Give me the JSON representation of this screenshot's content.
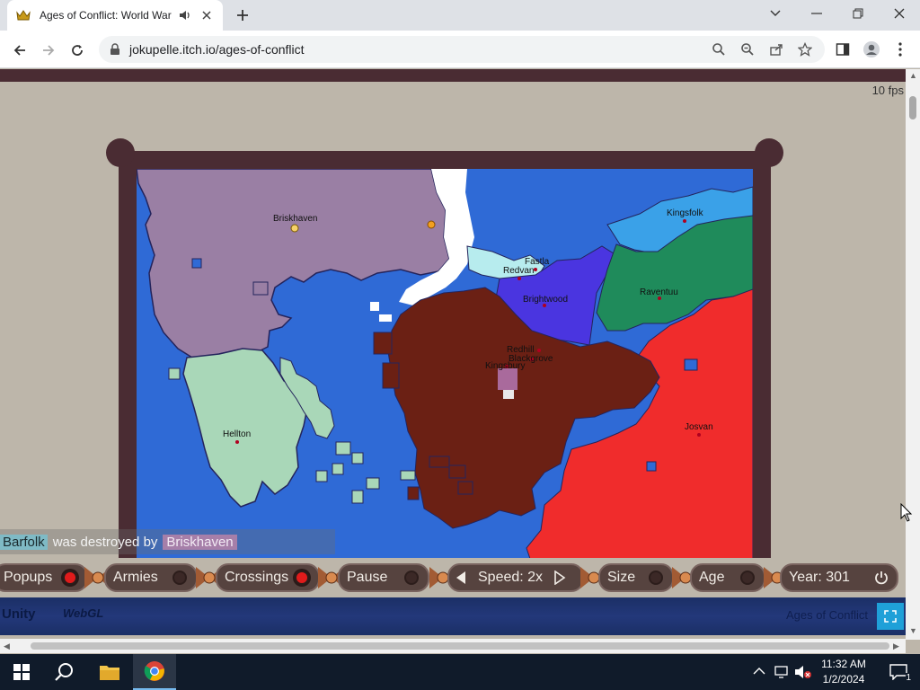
{
  "browser": {
    "tab_title": "Ages of Conflict: World War",
    "url": "jokupelle.itch.io/ages-of-conflict"
  },
  "game": {
    "fps": "10 fps",
    "cities": [
      {
        "name": "Briskhaven"
      },
      {
        "name": "Kingsfolk"
      },
      {
        "name": "Fastla"
      },
      {
        "name": "Redvan"
      },
      {
        "name": "Brightwood"
      },
      {
        "name": "Raventuu"
      },
      {
        "name": "Redhill"
      },
      {
        "name": "Blackgrove"
      },
      {
        "name": "Kingsbury"
      },
      {
        "name": "Hellton"
      },
      {
        "name": "Josvan"
      }
    ],
    "colors": {
      "ocean": "#2f6ad6",
      "purple": "#9a7fa4",
      "mint": "#a9d7b8",
      "brown": "#6b2014",
      "red": "#f02c2c",
      "green": "#1f8b5b",
      "lightblue": "#3aa1e8",
      "violet": "#4a35e0",
      "white": "#ffffff",
      "frame": "#4a2c33"
    },
    "notification": {
      "victim": "Barfolk",
      "text": "was destroyed by",
      "attacker": "Briskhaven"
    },
    "controls": {
      "popups": "Popups",
      "armies": "Armies",
      "crossings": "Crossings",
      "pause": "Pause",
      "speed": "Speed: 2x",
      "size": "Size",
      "age": "Age",
      "year": "Year: 301"
    },
    "toggles": {
      "popups": true,
      "armies": false,
      "crossings": true,
      "pause": false,
      "size": false,
      "age": false
    },
    "footer": {
      "unity": "Unity",
      "webgl": "WebGL",
      "game_name": "Ages of Conflict"
    }
  },
  "taskbar": {
    "time": "11:32 AM",
    "date": "1/2/2024",
    "notification_count": "1"
  }
}
